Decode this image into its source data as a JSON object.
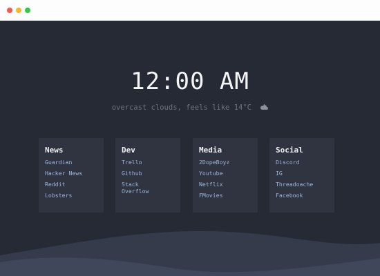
{
  "clock": {
    "time": "12:00 AM"
  },
  "weather": {
    "text": "overcast clouds, feels like 14°C",
    "icon": "cloud-icon"
  },
  "cards": [
    {
      "title": "News",
      "links": [
        "Guardian",
        "Hacker News",
        "Reddit",
        "Lobsters"
      ]
    },
    {
      "title": "Dev",
      "links": [
        "Trello",
        "Github",
        "Stack Overflow"
      ]
    },
    {
      "title": "Media",
      "links": [
        "2DopeBoyz",
        "Youtube",
        "Netflix",
        "FMovies"
      ]
    },
    {
      "title": "Social",
      "links": [
        "Discord",
        "IG",
        "Threadoache",
        "Facebook"
      ]
    }
  ],
  "colors": {
    "background": "#262a35",
    "card": "#2f3440",
    "link": "#9fb4d4",
    "wave_back": "#3a3f51",
    "wave_front": "#454b60"
  }
}
